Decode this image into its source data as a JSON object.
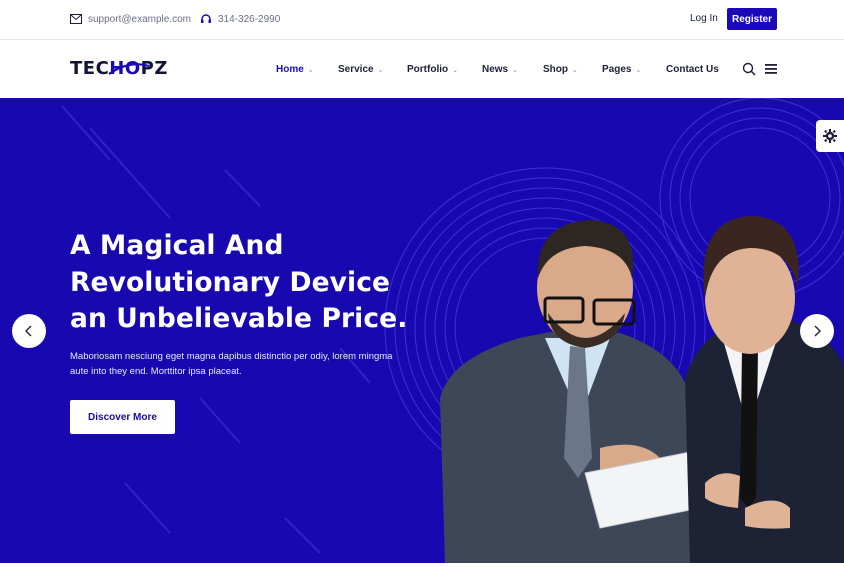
{
  "topbar": {
    "email": "support@example.com",
    "email_icon": "mail-icon",
    "phone": "314-326-2990",
    "phone_icon": "headset-icon",
    "login_label": "Log In",
    "register_label": "Register"
  },
  "brand": {
    "logo_prefix": "TEC",
    "logo_accent": "HO",
    "logo_suffix": "PZ",
    "accent_color": "#1a09b8"
  },
  "nav": {
    "items": [
      {
        "label": "Home",
        "dropdown": true,
        "active": true
      },
      {
        "label": "Service",
        "dropdown": true,
        "active": false
      },
      {
        "label": "Portfolio",
        "dropdown": true,
        "active": false
      },
      {
        "label": "News",
        "dropdown": true,
        "active": false
      },
      {
        "label": "Shop",
        "dropdown": true,
        "active": false
      },
      {
        "label": "Pages",
        "dropdown": true,
        "active": false
      },
      {
        "label": "Contact Us",
        "dropdown": false,
        "active": false
      }
    ],
    "search_icon": "search-icon",
    "menu_icon": "hamburger-menu-icon"
  },
  "hero": {
    "background_color": "#1808b0",
    "headline_line1": "A Magical And",
    "headline_line2": "Revolutionary Device",
    "headline_line3": "an Unbelievable Price.",
    "subtext": "Maboriosam nesciung eget magna dapibus distinctio per odiy, lorem mingma aute into they end. Morttitor ipsa placeat.",
    "cta_label": "Discover More",
    "prev_icon": "chevron-left-icon",
    "next_icon": "chevron-right-icon",
    "settings_icon": "gear-icon",
    "image_subject": "two businessmen reviewing a clipboard"
  }
}
